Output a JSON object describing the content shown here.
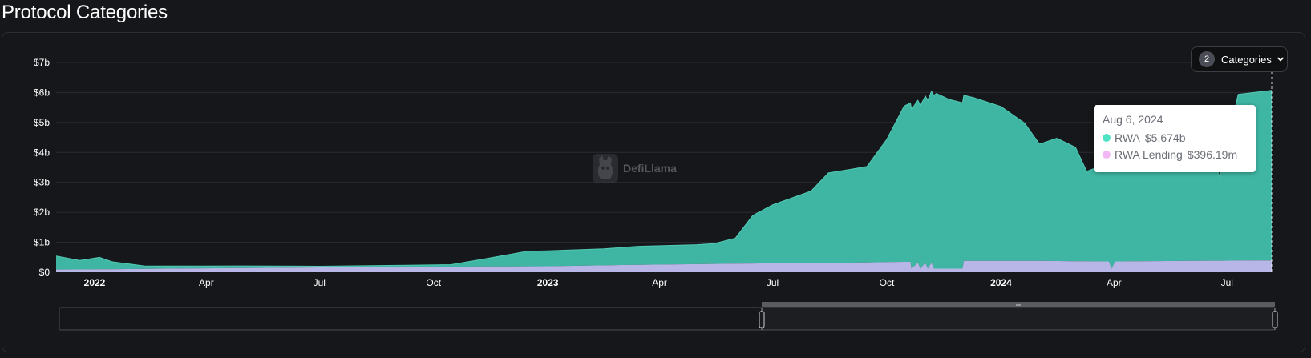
{
  "page": {
    "title": "Protocol Categories"
  },
  "controls": {
    "categories_count": "2",
    "categories_label": "Categories"
  },
  "watermark": {
    "text": "DefiLlama",
    "icon": "llama-logo-icon"
  },
  "tooltip": {
    "date": "Aug 6, 2024",
    "rows": [
      {
        "name": "RWA",
        "value": "$5.674b",
        "color": "#4fe3c6"
      },
      {
        "name": "RWA Lending",
        "value": "$396.19m",
        "color": "#f2b8f5"
      }
    ]
  },
  "colors": {
    "background": "#16171a",
    "rwa_fill": "#3fb6a3",
    "rwa_lending_fill": "#b8b6e6",
    "grid": "#2a2c31"
  },
  "chart_data": {
    "type": "area",
    "stacked": true,
    "xlim": [
      "2021-12-01",
      "2024-08-06"
    ],
    "ylim": [
      0,
      7000000000
    ],
    "grid": true,
    "y_ticks": [
      {
        "v": 0,
        "label": "$0"
      },
      {
        "v": 1000000000,
        "label": "$1b"
      },
      {
        "v": 2000000000,
        "label": "$2b"
      },
      {
        "v": 3000000000,
        "label": "$3b"
      },
      {
        "v": 4000000000,
        "label": "$4b"
      },
      {
        "v": 5000000000,
        "label": "$5b"
      },
      {
        "v": 6000000000,
        "label": "$6b"
      },
      {
        "v": 7000000000,
        "label": "$7b"
      }
    ],
    "x_ticks": [
      {
        "date": "2022-01-01",
        "label": "2022",
        "bold": true
      },
      {
        "date": "2022-04-01",
        "label": "Apr",
        "bold": false
      },
      {
        "date": "2022-07-01",
        "label": "Jul",
        "bold": false
      },
      {
        "date": "2022-10-01",
        "label": "Oct",
        "bold": false
      },
      {
        "date": "2023-01-01",
        "label": "2023",
        "bold": true
      },
      {
        "date": "2023-04-01",
        "label": "Apr",
        "bold": false
      },
      {
        "date": "2023-07-01",
        "label": "Jul",
        "bold": false
      },
      {
        "date": "2023-10-01",
        "label": "Oct",
        "bold": false
      },
      {
        "date": "2024-01-01",
        "label": "2024",
        "bold": true
      },
      {
        "date": "2024-04-01",
        "label": "Apr",
        "bold": false
      },
      {
        "date": "2024-07-01",
        "label": "Jul",
        "bold": false
      }
    ],
    "series": [
      {
        "name": "RWA Lending",
        "color": "#b8b6e6",
        "points": [
          [
            "2021-12-01",
            0.09
          ],
          [
            "2022-01-15",
            0.1
          ],
          [
            "2022-03-01",
            0.12
          ],
          [
            "2022-05-01",
            0.14
          ],
          [
            "2022-07-01",
            0.16
          ],
          [
            "2022-09-01",
            0.17
          ],
          [
            "2022-11-01",
            0.19
          ],
          [
            "2023-01-01",
            0.2
          ],
          [
            "2023-03-01",
            0.24
          ],
          [
            "2023-05-01",
            0.27
          ],
          [
            "2023-07-01",
            0.3
          ],
          [
            "2023-09-01",
            0.32
          ],
          [
            "2023-10-20",
            0.35
          ],
          [
            "2023-10-21",
            0.12
          ],
          [
            "2023-10-26",
            0.32
          ],
          [
            "2023-10-28",
            0.12
          ],
          [
            "2023-11-01",
            0.32
          ],
          [
            "2023-11-03",
            0.12
          ],
          [
            "2023-11-06",
            0.32
          ],
          [
            "2023-11-08",
            0.12
          ],
          [
            "2023-12-01",
            0.12
          ],
          [
            "2023-12-02",
            0.38
          ],
          [
            "2024-02-01",
            0.38
          ],
          [
            "2024-03-28",
            0.36
          ],
          [
            "2024-03-30",
            0.12
          ],
          [
            "2024-04-02",
            0.36
          ],
          [
            "2024-06-01",
            0.38
          ],
          [
            "2024-08-06",
            0.396
          ]
        ]
      },
      {
        "name": "RWA",
        "color": "#3fb6a3",
        "points": [
          [
            "2021-12-01",
            0.45
          ],
          [
            "2021-12-20",
            0.3
          ],
          [
            "2022-01-05",
            0.4
          ],
          [
            "2022-01-15",
            0.25
          ],
          [
            "2022-02-10",
            0.1
          ],
          [
            "2022-03-15",
            0.08
          ],
          [
            "2022-05-01",
            0.07
          ],
          [
            "2022-07-01",
            0.04
          ],
          [
            "2022-09-01",
            0.06
          ],
          [
            "2022-10-15",
            0.07
          ],
          [
            "2022-11-15",
            0.28
          ],
          [
            "2022-12-15",
            0.5
          ],
          [
            "2023-02-15",
            0.55
          ],
          [
            "2023-03-15",
            0.62
          ],
          [
            "2023-05-01",
            0.65
          ],
          [
            "2023-05-15",
            0.68
          ],
          [
            "2023-06-01",
            0.85
          ],
          [
            "2023-06-15",
            1.6
          ],
          [
            "2023-07-01",
            1.95
          ],
          [
            "2023-08-01",
            2.4
          ],
          [
            "2023-08-15",
            3.0
          ],
          [
            "2023-09-15",
            3.2
          ],
          [
            "2023-10-01",
            4.1
          ],
          [
            "2023-10-15",
            5.2
          ],
          [
            "2023-10-30",
            5.5
          ],
          [
            "2023-11-10",
            5.85
          ],
          [
            "2023-11-20",
            5.65
          ],
          [
            "2023-12-10",
            5.45
          ],
          [
            "2024-01-01",
            5.15
          ],
          [
            "2024-01-20",
            4.6
          ],
          [
            "2024-02-01",
            3.9
          ],
          [
            "2024-02-15",
            4.1
          ],
          [
            "2024-03-01",
            3.8
          ],
          [
            "2024-03-10",
            3.0
          ],
          [
            "2024-03-25",
            3.25
          ],
          [
            "2024-04-10",
            3.35
          ],
          [
            "2024-05-15",
            3.35
          ],
          [
            "2024-06-20",
            3.5
          ],
          [
            "2024-06-25",
            2.8
          ],
          [
            "2024-07-10",
            5.55
          ],
          [
            "2024-08-06",
            5.674
          ]
        ]
      }
    ]
  }
}
